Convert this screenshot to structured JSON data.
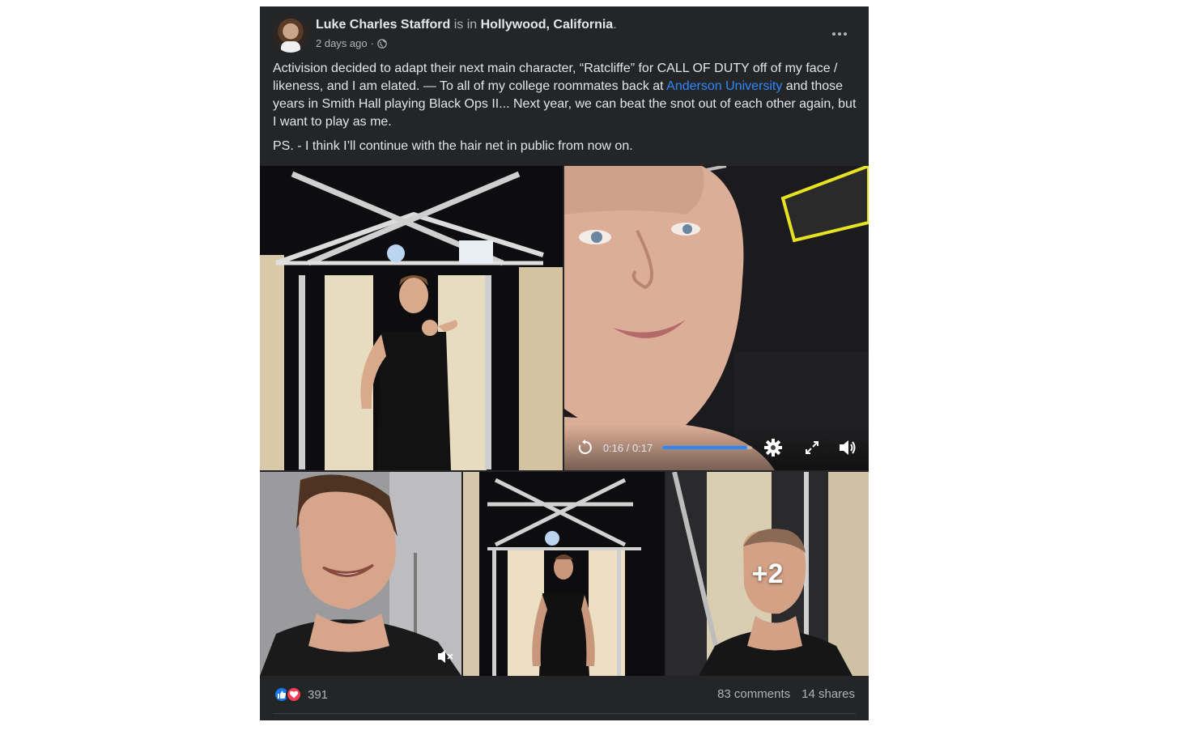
{
  "author": {
    "name": "Luke Charles Stafford",
    "connector": "is in",
    "location": "Hollywood, California",
    "location_suffix": ".",
    "timestamp": "2 days ago",
    "separator": "·",
    "audience_icon": "globe-icon"
  },
  "more_icon": "more-horizontal-icon",
  "post": {
    "paragraph1_before_link": "Activision decided to adapt their next main character, “Ratcliffe” for CALL OF DUTY off of my face / likeness, and I am elated. — To all of my college roommates back at ",
    "link_text": "Anderson University",
    "paragraph1_after_link": " and those years in Smith Hall playing Black Ops II... Next year, we can beat the snot out of each other again, but I want to play as me.",
    "paragraph2": "PS. - I think I’ll continue with the hair net in public from now on."
  },
  "video": {
    "time": "0:16 / 0:17",
    "progress": 0.94,
    "icons": [
      "replay-icon",
      "gear-icon",
      "expand-icon",
      "volume-icon"
    ]
  },
  "photos": {
    "extra_count": "+2",
    "muted_icon": "volume-muted-icon"
  },
  "reactions": {
    "icons": [
      "like-icon",
      "love-icon"
    ],
    "count": "391"
  },
  "stats": {
    "comments": "83 comments",
    "shares": "14 shares"
  },
  "colors": {
    "card_bg": "#242526",
    "text": "#e4e6eb",
    "muted": "#b0b3b8",
    "link": "#2d88ff",
    "like": "#1877f2",
    "love": "#f33e58"
  }
}
